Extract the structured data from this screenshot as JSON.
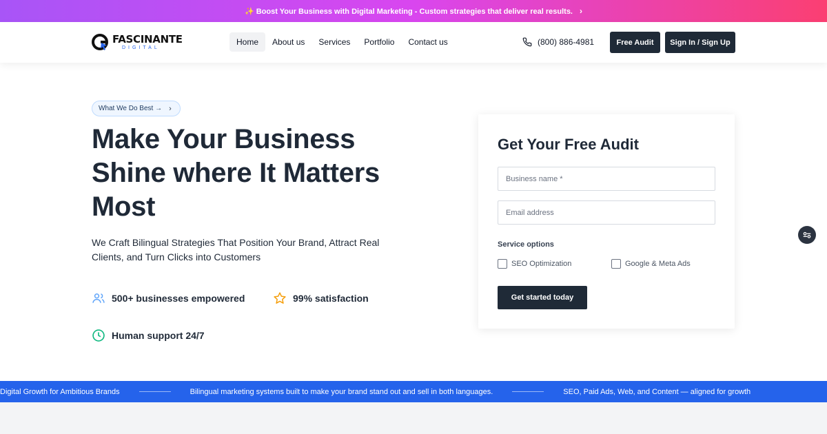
{
  "promo": {
    "icon": "sparkles-icon",
    "text": "✨ Boost Your Business with Digital Marketing - Custom strategies that deliver real results.",
    "chevron": "›"
  },
  "header": {
    "logo_name": "FASCINANTE",
    "logo_sub": "DIGITAL",
    "nav": [
      {
        "label": "Home",
        "active": true
      },
      {
        "label": "About us"
      },
      {
        "label": "Services"
      },
      {
        "label": "Portfolio"
      },
      {
        "label": "Contact us"
      }
    ],
    "phone": "(800) 886-4981",
    "audit_label": "Free Audit",
    "sign_label": "Sign In / Sign Up"
  },
  "hero": {
    "pill_label": "What We Do Best →",
    "pill_chevron": "›",
    "title": "Make Your Business Shine where It Matters Most",
    "subtitle": "We Craft Bilingual Strategies That Position Your Brand, Attract Real Clients, and Turn Clicks into Customers",
    "stats": [
      {
        "icon": "users-icon",
        "label": "500+ businesses empowered"
      },
      {
        "icon": "star-icon",
        "label": "99% satisfaction"
      },
      {
        "icon": "clock-icon",
        "label": "Human support 24/7"
      }
    ]
  },
  "form": {
    "title": "Get Your Free Audit",
    "business_placeholder": "Business name *",
    "email_placeholder": "Email address",
    "service_label": "Service options",
    "options": [
      "SEO Optimization",
      "Google & Meta Ads"
    ],
    "submit_label": "Get started today"
  },
  "ticker": {
    "items": [
      "Digital Growth for Ambitious Brands",
      "Bilingual marketing systems built to make your brand stand out and sell in both languages.",
      "SEO, Paid Ads, Web, and Content — aligned for growth"
    ]
  },
  "colors": {
    "accent": "#2563eb",
    "dark": "#1f2a37",
    "promo_start": "#a855f7",
    "promo_end": "#fb3f72"
  }
}
